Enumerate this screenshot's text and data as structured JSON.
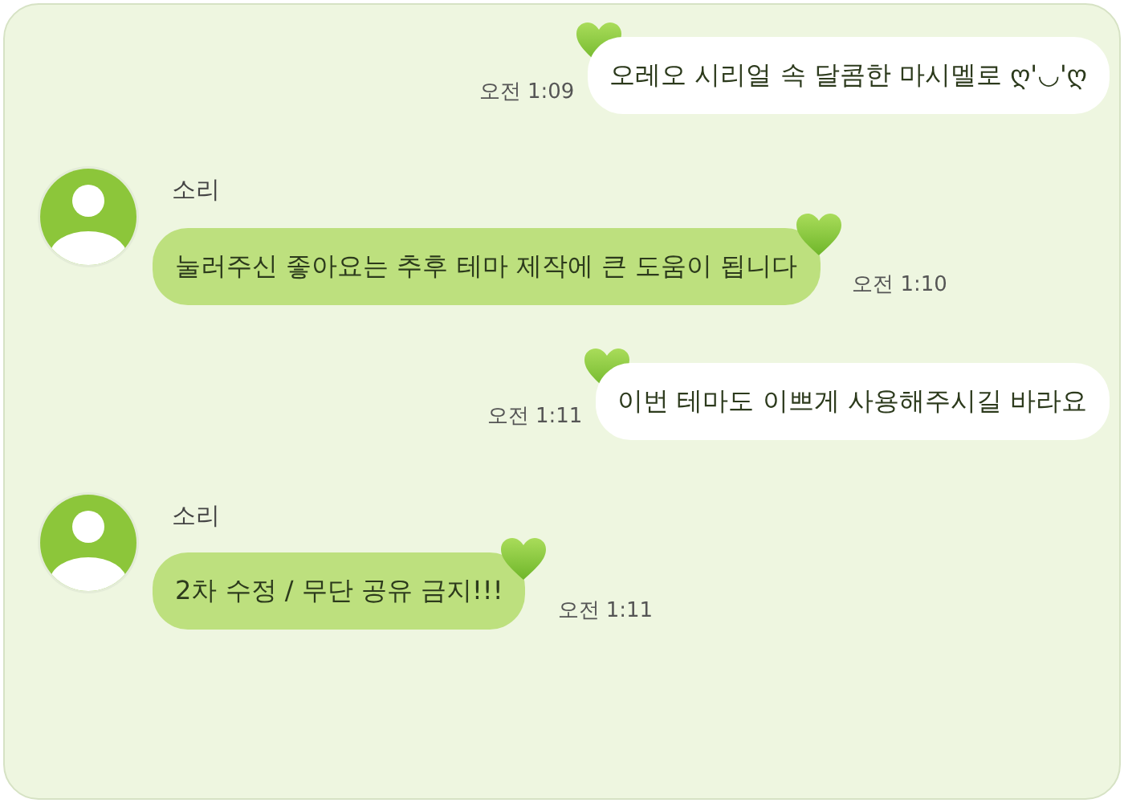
{
  "messages": [
    {
      "kind": "sent",
      "text": "오레오 시리얼 속 달콤한 마시멜로 ღ'◡'ღ",
      "time": "오전 1:09"
    },
    {
      "kind": "received",
      "sender": "소리",
      "text": "눌러주신 좋아요는 추후 테마 제작에 큰 도움이 됩니다",
      "time": "오전 1:10"
    },
    {
      "kind": "sent",
      "text": "이번 테마도 이쁘게 사용해주시길 바라요",
      "time": "오전 1:11"
    },
    {
      "kind": "received",
      "sender": "소리",
      "text": "2차 수정 / 무단 공유 금지!!!",
      "time": "오전 1:11"
    }
  ]
}
